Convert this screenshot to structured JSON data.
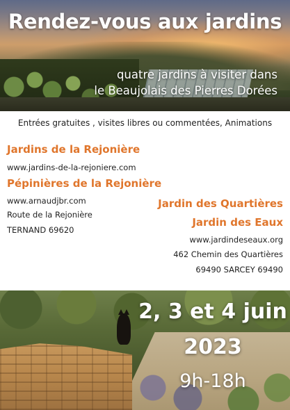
{
  "header": {
    "title": "Rendez-vous aux jardins",
    "subtitle_line1": "quatre jardins à visiter dans",
    "subtitle_line2": "le Beaujolais des Pierres Dorées"
  },
  "info": {
    "entries": "Entrées gratuites , visites libres ou commentées, Animations"
  },
  "left_venue": {
    "name1": "Jardins de la Rejonière",
    "url1": "www.jardins-de-la-rejoniere.com",
    "name2": "Pépinières de la Rejonière",
    "url2": "www.arnaudjbr.com",
    "address": "Route de la Rejonière",
    "city": "TERNAND 69620"
  },
  "right_venue": {
    "name1": "Jardin des Quartières",
    "name2": "Jardin des Eaux",
    "url": "www.jardindeseaux.org",
    "address": "462 Chemin des Quartières",
    "city": "69490 SARCEY 69490"
  },
  "event": {
    "dates": "2, 3 et 4 juin",
    "year": "2023",
    "hours": "9h-18h"
  },
  "colors": {
    "accent": "#e0762c",
    "text": "#222222"
  }
}
